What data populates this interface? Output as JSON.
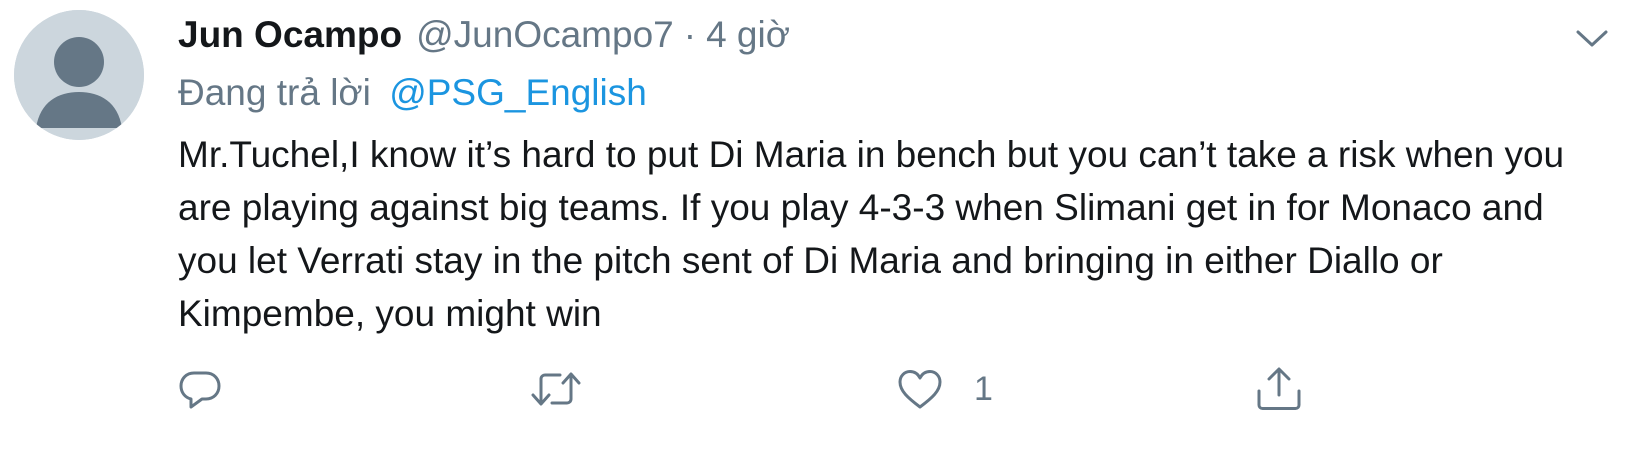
{
  "tweet": {
    "author_name": "Jun Ocampo",
    "author_handle": "@JunOcampo7",
    "separator": "·",
    "time": "4 giờ",
    "replying_to_label": "Đang trả lời",
    "replying_to_handle": "@PSG_English",
    "text": "Mr.Tuchel,I know it’s hard to put Di Maria in bench but you can’t take a risk when you are playing against big teams. If you play 4-3-3 when Slimani get in for Monaco and you let Verrati stay in the pitch sent of Di Maria and bringing in either Diallo or Kimpembe, you might win"
  },
  "actions": {
    "reply": {
      "icon": "reply-icon",
      "count": ""
    },
    "retweet": {
      "icon": "retweet-icon",
      "count": ""
    },
    "like": {
      "icon": "heart-icon",
      "count": "1"
    },
    "share": {
      "icon": "share-icon",
      "count": ""
    }
  },
  "menu": {
    "icon": "chevron-down-icon"
  },
  "colors": {
    "text_primary": "#14171a",
    "text_secondary": "#657786",
    "link": "#1b95e0",
    "avatar_bg": "#ccd6dd",
    "avatar_fg": "#657786"
  }
}
